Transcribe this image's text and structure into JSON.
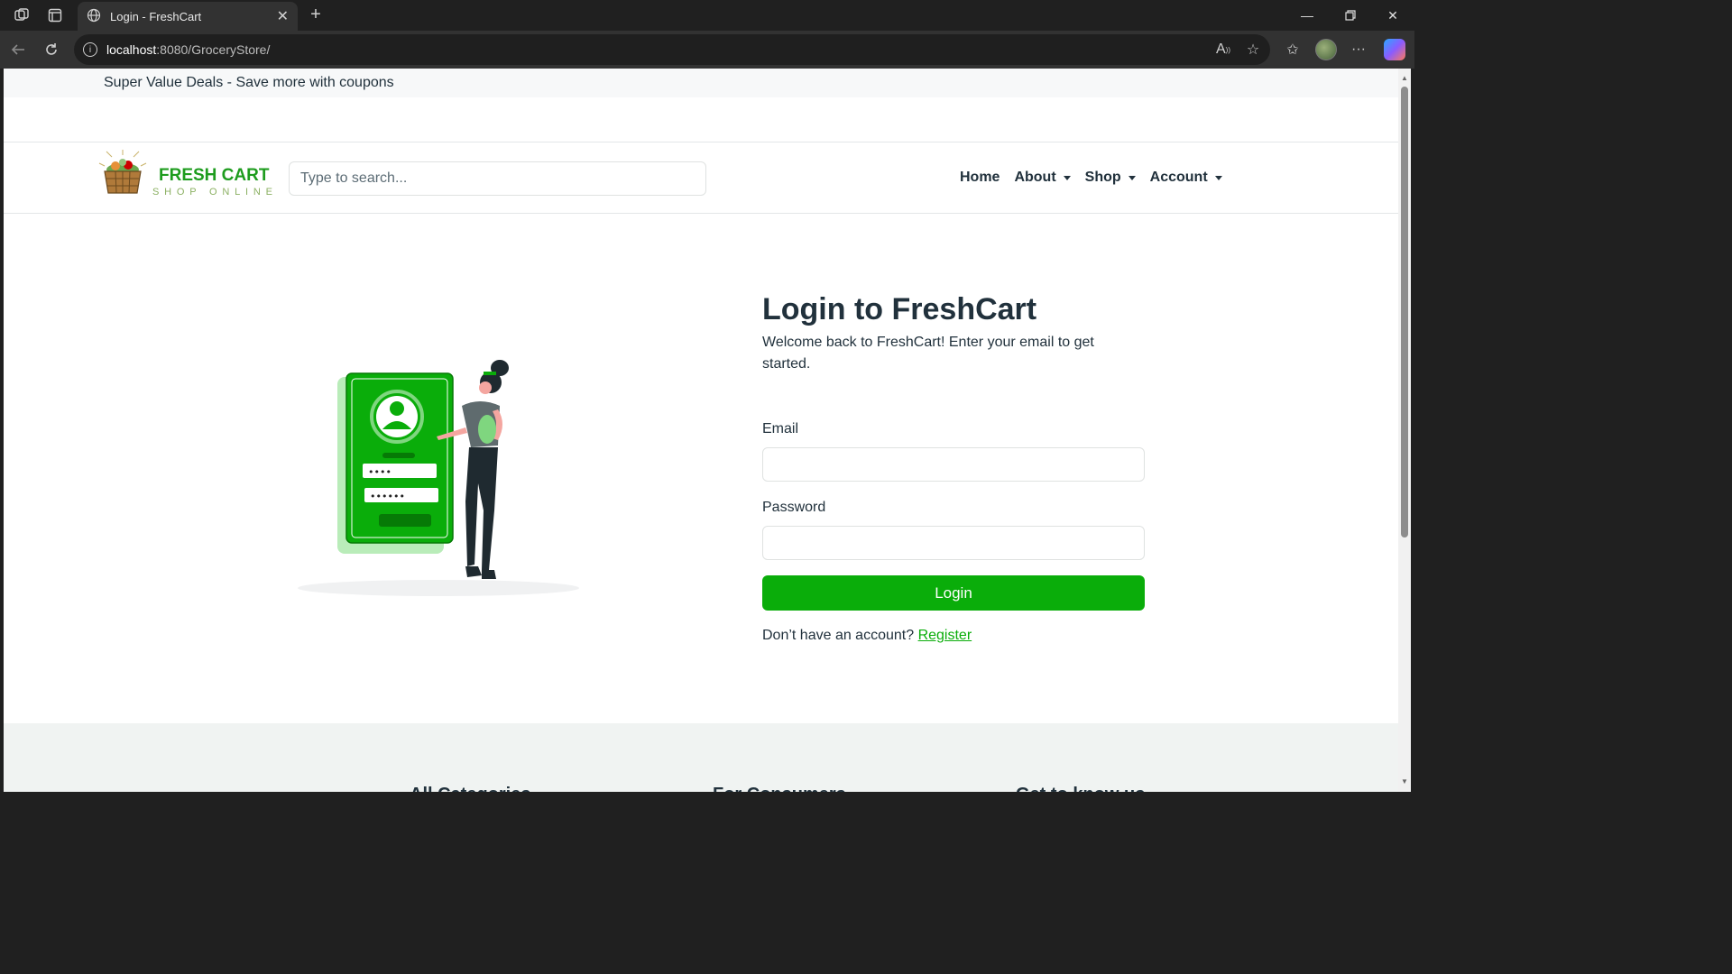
{
  "browser": {
    "tab_title": "Login - FreshCart",
    "url_host": "localhost",
    "url_path": ":8080/GroceryStore/"
  },
  "promo": {
    "text": "Super Value Deals - Save more with coupons"
  },
  "logo": {
    "line1": "FRESH CART",
    "line2": "SHOP ONLINE"
  },
  "search": {
    "placeholder": "Type to search..."
  },
  "nav": {
    "home": "Home",
    "about": "About",
    "shop": "Shop",
    "account": "Account"
  },
  "login": {
    "title": "Login to FreshCart",
    "subtitle": "Welcome back to FreshCart! Enter your email to get started.",
    "email_label": "Email",
    "email_value": "",
    "password_label": "Password",
    "password_value": "",
    "button": "Login",
    "no_account": "Don’t have an account?",
    "register": "Register"
  },
  "illustration": {
    "masked_short": "••••",
    "masked_long": "••••••"
  },
  "footer": {
    "headings": [
      "All Categories",
      "For Consumers",
      "Get to know us"
    ]
  },
  "colors": {
    "brand_green": "#0aad0a",
    "text_dark": "#21313c"
  }
}
